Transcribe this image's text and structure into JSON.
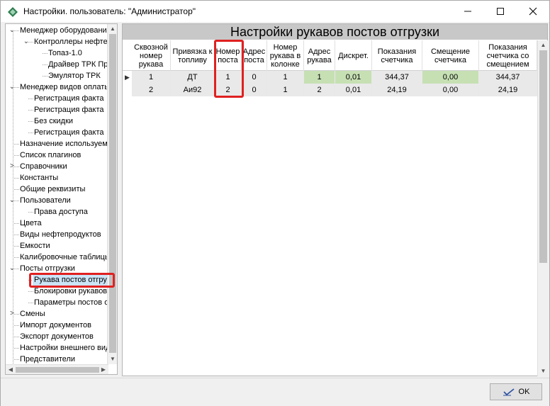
{
  "window": {
    "title": "Настройки. пользователь: \"Администратор\"",
    "minimize": "—",
    "maximize": "☐",
    "close": "✕"
  },
  "tree": {
    "items": [
      {
        "label": "Менеджер оборудования",
        "level": 0,
        "toggle": "⌄"
      },
      {
        "label": "Контроллеры нефтепродуктов",
        "level": 1,
        "toggle": "⌄"
      },
      {
        "label": "Топаз-1.0",
        "level": 2,
        "toggle": ""
      },
      {
        "label": "Драйвер ТРК Пр",
        "level": 2,
        "toggle": ""
      },
      {
        "label": "Эмулятор ТРК",
        "level": 2,
        "toggle": ""
      },
      {
        "label": "Менеджер видов оплаты",
        "level": 0,
        "toggle": "⌄"
      },
      {
        "label": "Регистрация факта",
        "level": 1,
        "toggle": ""
      },
      {
        "label": "Регистрация факта",
        "level": 1,
        "toggle": ""
      },
      {
        "label": "Без скидки",
        "level": 1,
        "toggle": ""
      },
      {
        "label": "Регистрация факта",
        "level": 1,
        "toggle": ""
      },
      {
        "label": "Назначение используемых",
        "level": 0,
        "toggle": ""
      },
      {
        "label": "Список плагинов",
        "level": 0,
        "toggle": ""
      },
      {
        "label": "Справочники",
        "level": 0,
        "toggle": ">"
      },
      {
        "label": "Константы",
        "level": 0,
        "toggle": ""
      },
      {
        "label": "Общие реквизиты",
        "level": 0,
        "toggle": ""
      },
      {
        "label": "Пользователи",
        "level": 0,
        "toggle": "⌄"
      },
      {
        "label": "Права доступа",
        "level": 1,
        "toggle": ""
      },
      {
        "label": "Цвета",
        "level": 0,
        "toggle": ""
      },
      {
        "label": "Виды нефтепродуктов",
        "level": 0,
        "toggle": ""
      },
      {
        "label": "Емкости",
        "level": 0,
        "toggle": ""
      },
      {
        "label": "Калибровочные таблицы",
        "level": 0,
        "toggle": ""
      },
      {
        "label": "Посты отгрузки",
        "level": 0,
        "toggle": "⌄"
      },
      {
        "label": "Рукава постов отгрузки",
        "level": 1,
        "toggle": "",
        "selected": true
      },
      {
        "label": "Блокировки рукавов",
        "level": 1,
        "toggle": ""
      },
      {
        "label": "Параметры постов отгрузки",
        "level": 1,
        "toggle": ""
      },
      {
        "label": "Смены",
        "level": 0,
        "toggle": ">"
      },
      {
        "label": "Импорт документов",
        "level": 0,
        "toggle": ""
      },
      {
        "label": "Экспорт документов",
        "level": 0,
        "toggle": ""
      },
      {
        "label": "Настройки внешнего вида",
        "level": 0,
        "toggle": ""
      },
      {
        "label": "Представители",
        "level": 0,
        "toggle": ""
      }
    ]
  },
  "panel": {
    "title": "Настройки рукавов постов отгрузки"
  },
  "grid": {
    "columns": [
      {
        "label": "Сквозной номер рукава"
      },
      {
        "label": "Привязка к топливу"
      },
      {
        "label": "Номер поста"
      },
      {
        "label": "Адрес поста"
      },
      {
        "label": "Номер рукава в колонке"
      },
      {
        "label": "Адрес рукава"
      },
      {
        "label": "Дискрет."
      },
      {
        "label": "Показания счетчика"
      },
      {
        "label": "Смещение счетчика"
      },
      {
        "label": "Показания счетчика со смещением"
      }
    ],
    "rows": [
      {
        "current": "▶",
        "cells": [
          "1",
          "ДТ",
          "1",
          "0",
          "1",
          "1",
          "0,01",
          "344,37",
          "0,00",
          "344,37"
        ]
      },
      {
        "current": "",
        "cells": [
          "2",
          "Аи92",
          "2",
          "0",
          "1",
          "2",
          "0,01",
          "24,19",
          "0,00",
          "24,19"
        ]
      }
    ]
  },
  "footer": {
    "ok_label": "OK"
  },
  "colors": {
    "highlight": "#e02020",
    "green_cell": "#c6e0b4",
    "header_bg": "#c8c8c8"
  }
}
